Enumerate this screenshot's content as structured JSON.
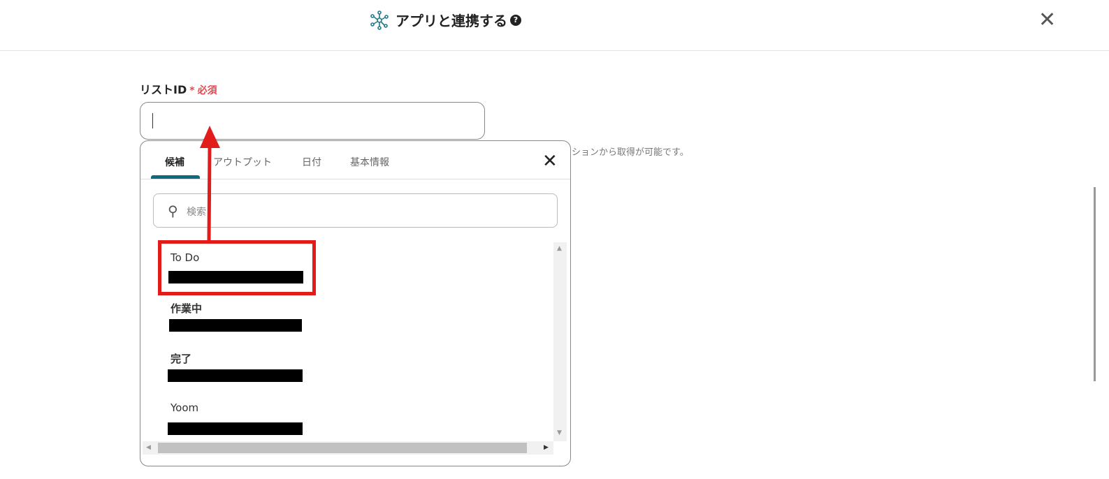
{
  "header": {
    "title": "アプリと連携する",
    "help_icon": "question-circle-icon",
    "close_icon": "close-icon",
    "app_icon": "network-hub-icon"
  },
  "field": {
    "label": "リストID",
    "required_mark": "*",
    "required_text": "必須",
    "value": "",
    "hint": "ションから取得が可能です。"
  },
  "panel": {
    "tabs": [
      {
        "label": "候補",
        "active": true
      },
      {
        "label": "アウトプット"
      },
      {
        "label": "日付"
      },
      {
        "label": "基本情報"
      }
    ],
    "search_placeholder": "検索",
    "items": [
      {
        "name": "To Do",
        "highlighted": true
      },
      {
        "name": "作業中"
      },
      {
        "name": "完了"
      },
      {
        "name": "Yoom"
      }
    ]
  },
  "colors": {
    "accent": "#0f6a80",
    "required": "#e8474f",
    "annotation": "#e21b1b"
  }
}
